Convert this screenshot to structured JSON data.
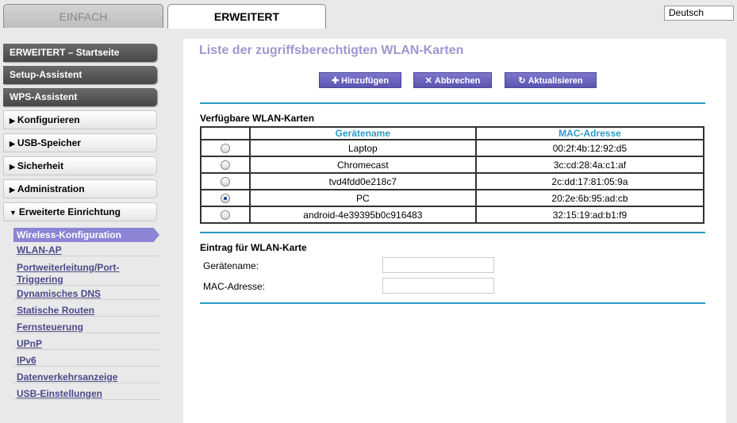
{
  "tabs": {
    "simple": "EINFACH",
    "advanced": "ERWEITERT"
  },
  "language": "Deutsch",
  "nav": {
    "main_items": [
      {
        "label": "ERWEITERT – Startseite"
      },
      {
        "label": "Setup-Assistent"
      },
      {
        "label": "WPS-Assistent"
      }
    ],
    "expandable_items": [
      {
        "label": "Konfigurieren",
        "arrow": "▶"
      },
      {
        "label": "USB-Speicher",
        "arrow": "▶"
      },
      {
        "label": "Sicherheit",
        "arrow": "▶"
      },
      {
        "label": "Administration",
        "arrow": "▶"
      },
      {
        "label": "Erweiterte Einrichtung",
        "arrow": "▼"
      }
    ],
    "sub_active": "Wireless-Konfiguration",
    "sub_items": [
      "WLAN-AP",
      "Portweiterleitung/Port-",
      "Triggering",
      "Dynamisches DNS",
      "Statische Routen",
      "Fernsteuerung",
      "UPnP",
      "IPv6",
      "Datenverkehrsanzeige",
      "USB-Einstellungen"
    ]
  },
  "main": {
    "title": "Liste der zugriffsberechtigten WLAN-Karten",
    "buttons": {
      "add": "Hinzufügen",
      "cancel": "Abbrechen",
      "refresh": "Aktualisieren"
    },
    "available_title": "Verfügbare WLAN-Karten",
    "table": {
      "headers": [
        "Gerätename",
        "MAC-Adresse"
      ],
      "rows": [
        {
          "name": "Laptop",
          "mac": "00:2f:4b:12:92:d5",
          "selected": false
        },
        {
          "name": "Chromecast",
          "mac": "3c:cd:28:4a:c1:af",
          "selected": false
        },
        {
          "name": "tvd4fdd0e218c7",
          "mac": "2c:dd:17:81:05:9a",
          "selected": false
        },
        {
          "name": "PC",
          "mac": "20:2e:6b:95:ad:cb",
          "selected": true
        },
        {
          "name": "android-4e39395b0c916483",
          "mac": "32:15:19:ad:b1:f9",
          "selected": false
        }
      ]
    },
    "entry_title": "Eintrag für WLAN-Karte",
    "form": {
      "device_name_label": "Gerätename:",
      "device_name_value": "",
      "mac_label": "MAC-Adresse:",
      "mac_value": ""
    }
  },
  "colors": {
    "accent": "#8c84d4",
    "title": "#9e97d1",
    "line": "#2b9bc5",
    "header_text": "#2b9bc5"
  }
}
